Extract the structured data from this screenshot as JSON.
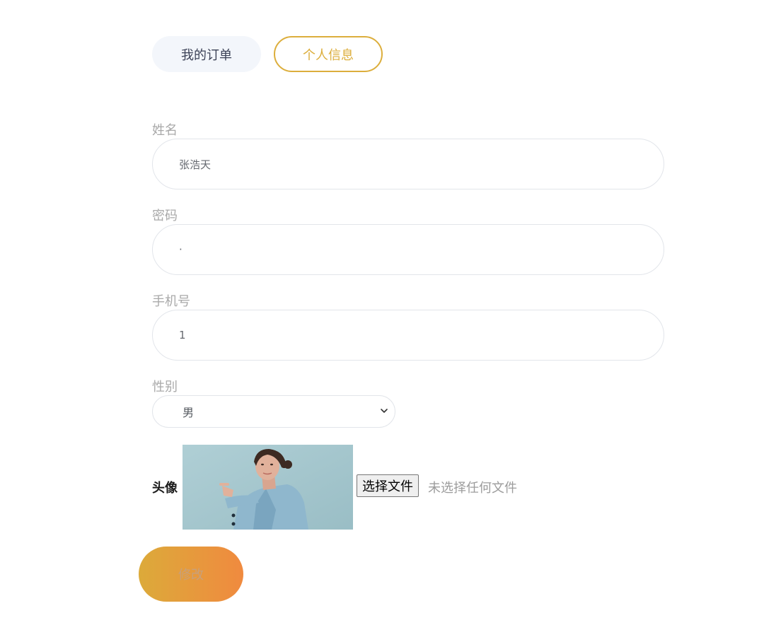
{
  "tabs": [
    {
      "label": "我的订单",
      "active": false
    },
    {
      "label": "个人信息",
      "active": true
    }
  ],
  "form": {
    "name": {
      "label": "姓名",
      "value": "张浩天"
    },
    "password": {
      "label": "密码",
      "value": "·"
    },
    "phone": {
      "label": "手机号",
      "value": "1"
    },
    "gender": {
      "label": "性别",
      "selected": "男"
    },
    "avatar": {
      "label": "头像",
      "file_button_label": "选择文件",
      "file_status": "未选择任何文件"
    },
    "submit_label": "修改"
  },
  "colors": {
    "accent": "#dcae3c",
    "gradient_start": "#dcaa3a",
    "gradient_end": "#f08a3f",
    "label_gray": "#a9a9a9"
  },
  "icons": {
    "select_chevron": "chevron-down-icon"
  }
}
